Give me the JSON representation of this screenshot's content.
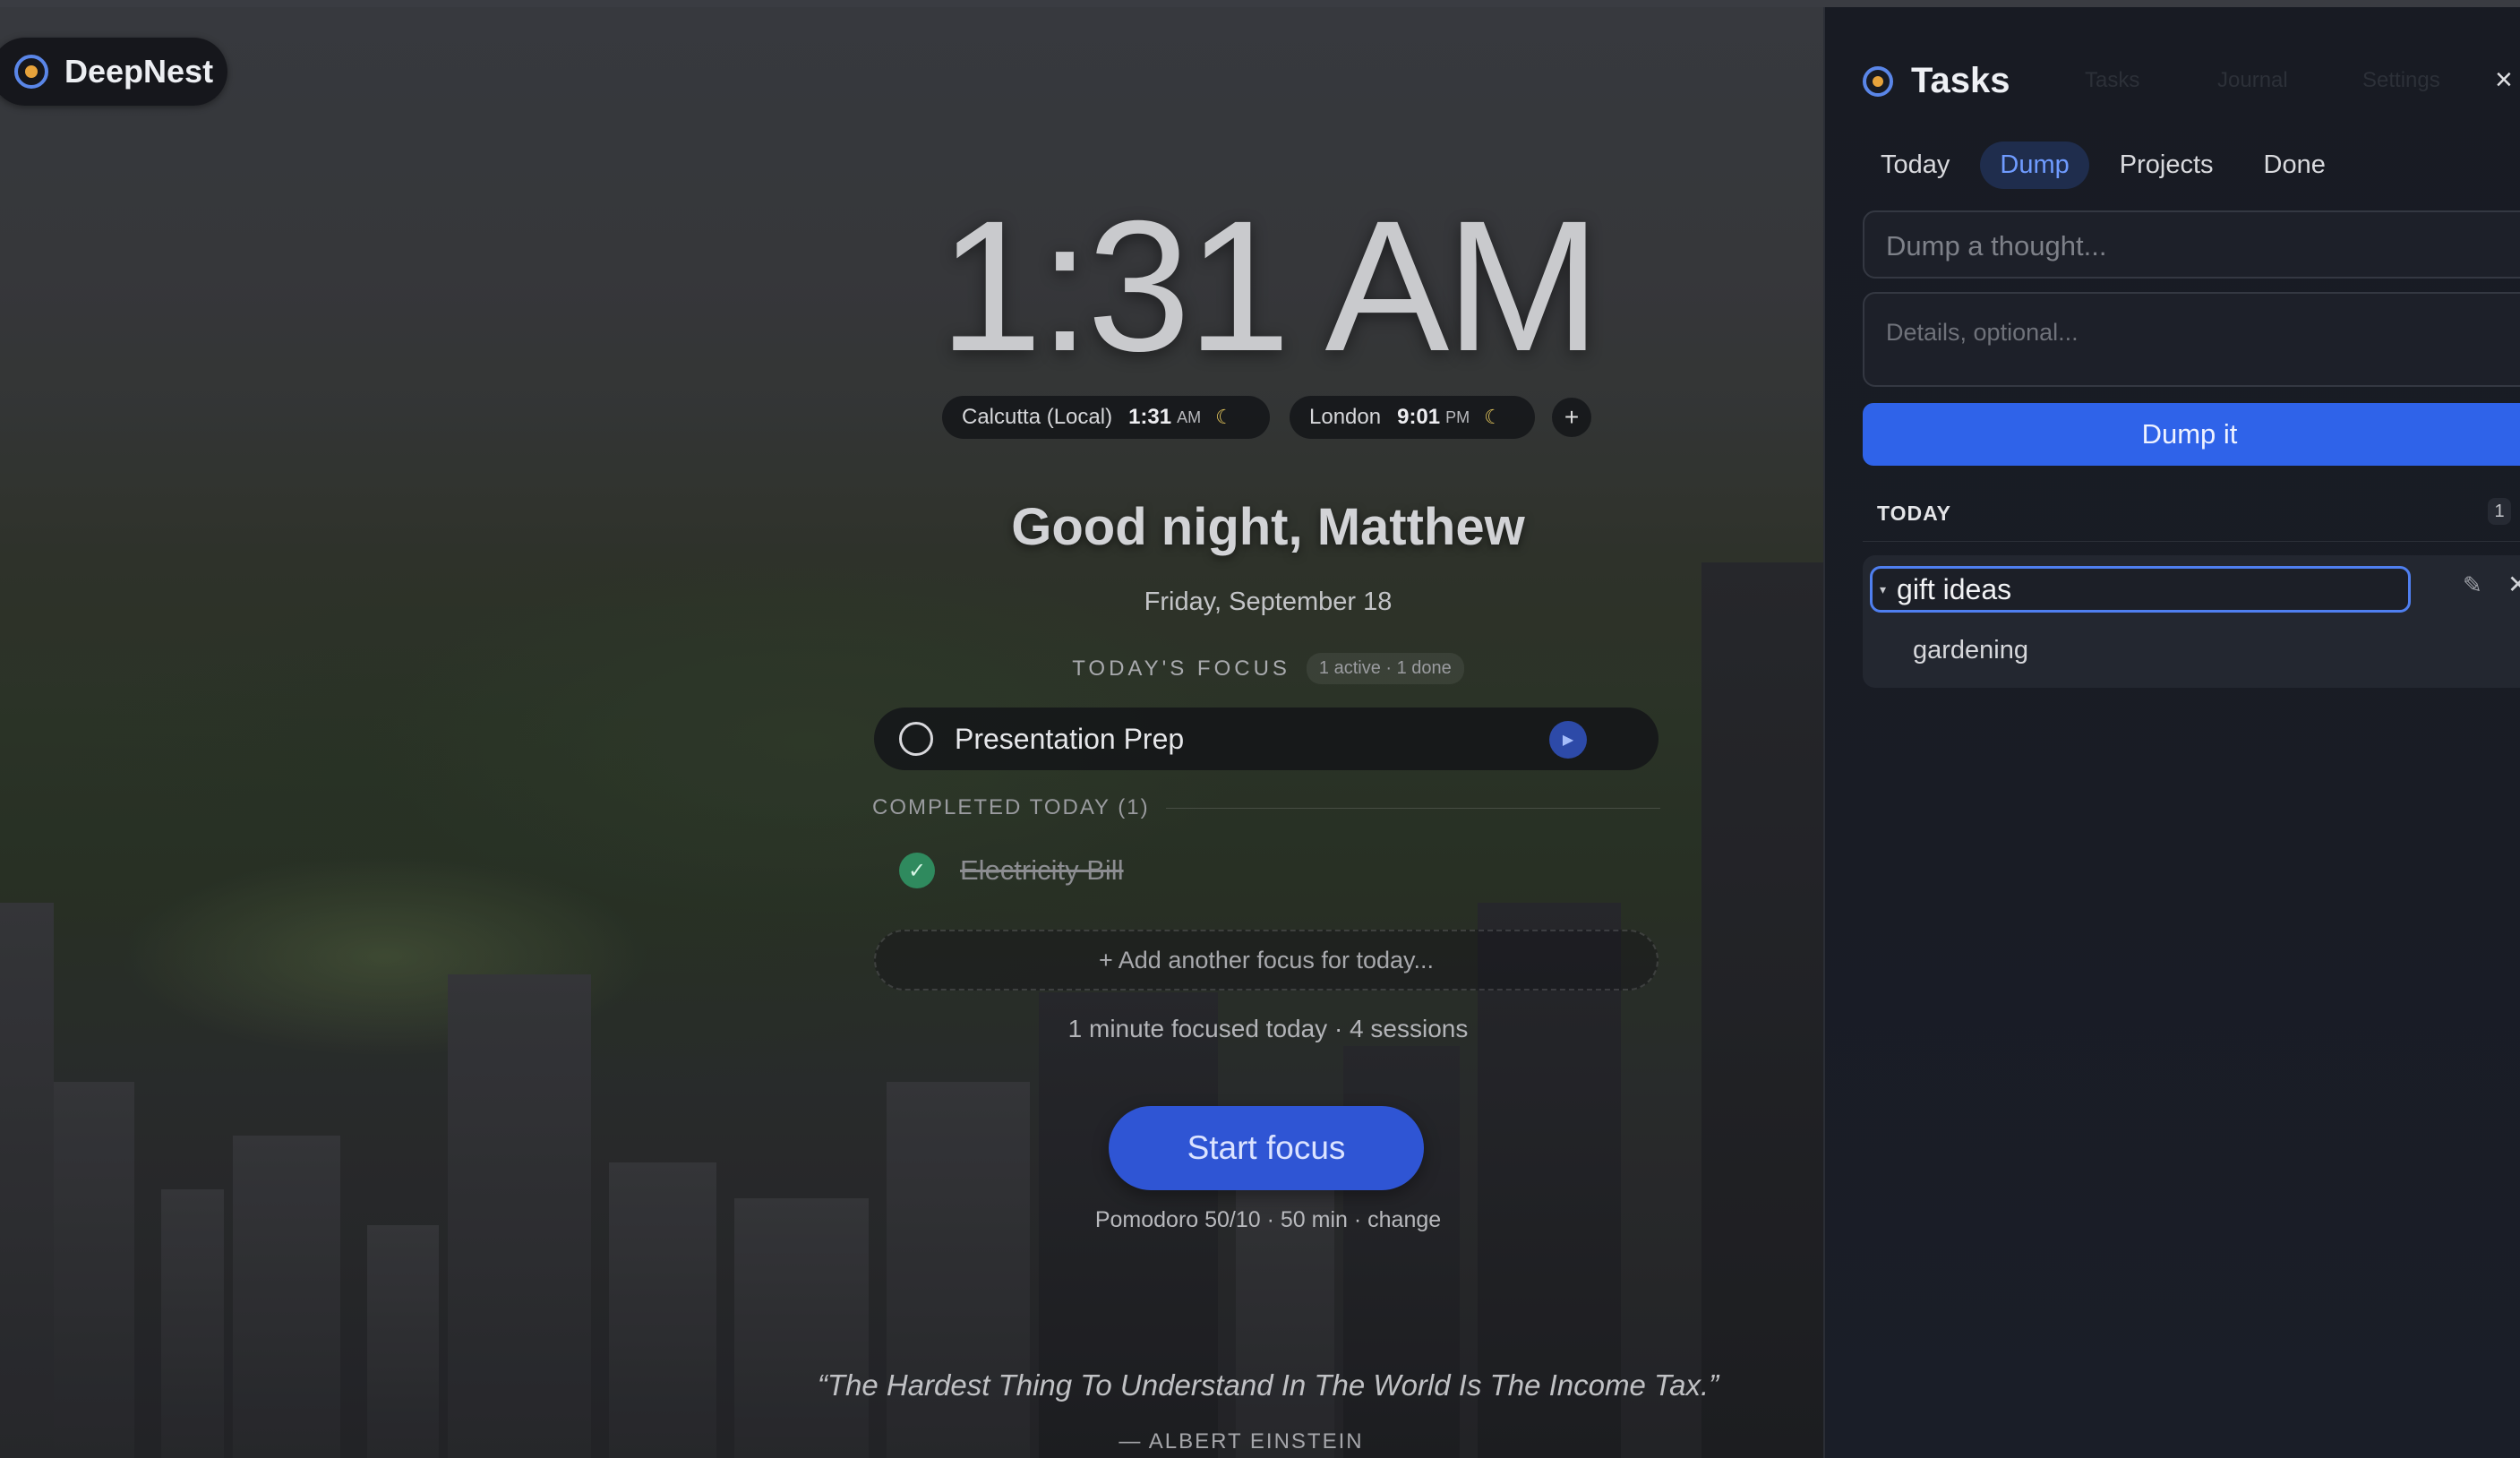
{
  "app": {
    "name": "DeepNest"
  },
  "clock": {
    "time": "1:31 AM"
  },
  "timezones": [
    {
      "city": "Calcutta (Local)",
      "time": "1:31",
      "ampm": "AM",
      "icon": "moon-icon"
    },
    {
      "city": "London",
      "time": "9:01",
      "ampm": "PM",
      "icon": "moon-icon"
    }
  ],
  "timezone_add": "+",
  "greeting": "Good night, Matthew",
  "date": "Friday, September 18",
  "focus": {
    "heading": "TODAY'S FOCUS",
    "badge": "1 active · 1 done",
    "active_task": "Presentation Prep",
    "completed_heading": "COMPLETED TODAY (1)",
    "completed_task": "Electricity Bill",
    "add_placeholder": "+ Add another focus for today..."
  },
  "stats": "1 minute focused today · 4 sessions",
  "start_button": "Start focus",
  "pomodoro": "Pomodoro 50/10 · 50 min · change",
  "quote": {
    "text": "“The Hardest Thing To Understand In The World Is The Income Tax.”",
    "author": "— ALBERT EINSTEIN"
  },
  "panel": {
    "title": "Tasks",
    "ghost_nav": [
      "Tasks",
      "Journal",
      "Settings"
    ],
    "close": "×",
    "tabs": [
      "Today",
      "Dump",
      "Projects",
      "Done"
    ],
    "active_tab": "Dump",
    "thought_placeholder": "Dump a thought...",
    "details_placeholder": "Details, optional...",
    "dump_button": "Dump it",
    "section": "TODAY",
    "section_count": "1",
    "editing_value": "gift ideas",
    "edit_icon": "pencil-icon",
    "delete_icon": "close-icon",
    "subtask": "gardening"
  },
  "colors": {
    "accent": "#2f63e9",
    "start": "#2f55d4",
    "active_tab": "#6f9bff",
    "done_check": "#2f8a5e",
    "logo_dot": "#e7a33b"
  }
}
